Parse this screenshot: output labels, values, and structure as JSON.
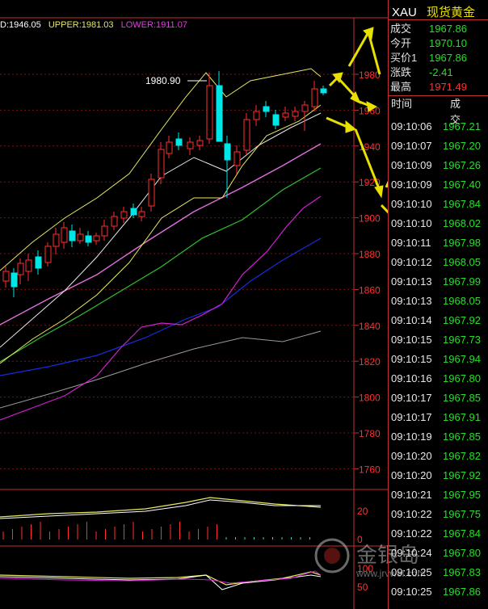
{
  "indicator_bar": {
    "mid": "D:1946.05",
    "upper": "UPPER:1981.03",
    "lower": "LOWER:1911.07"
  },
  "price_axis": [
    "1980",
    "1960",
    "1940",
    "1920",
    "1900",
    "1880",
    "1860",
    "1840",
    "1820",
    "1800",
    "1780",
    "1760"
  ],
  "high_annotation": "1980.90",
  "sub_axis_1": [
    "20",
    "0"
  ],
  "sub_axis_2": [
    "100",
    "50"
  ],
  "quote": {
    "symbol": "XAU",
    "name": "现货黄金",
    "rows": [
      {
        "label": "成交",
        "value": "1967.86",
        "color": "#25e025"
      },
      {
        "label": "今开",
        "value": "1970.10",
        "color": "#25e025"
      },
      {
        "label": "买价1",
        "value": "1967.86",
        "color": "#25e025"
      },
      {
        "label": "涨跌",
        "value": "-2.41",
        "color": "#25e025"
      },
      {
        "label": "最高",
        "value": "1971.49",
        "color": "#ff3030"
      }
    ]
  },
  "ticks": {
    "headers": {
      "time": "时间",
      "price": "成交"
    },
    "rows": [
      {
        "time": "09:10:06",
        "price": "1967.21"
      },
      {
        "time": "09:10:07",
        "price": "1967.20"
      },
      {
        "time": "09:10:09",
        "price": "1967.26"
      },
      {
        "time": "09:10:09",
        "price": "1967.40"
      },
      {
        "time": "09:10:10",
        "price": "1967.84"
      },
      {
        "time": "09:10:10",
        "price": "1968.02"
      },
      {
        "time": "09:10:11",
        "price": "1967.98"
      },
      {
        "time": "09:10:12",
        "price": "1968.05"
      },
      {
        "time": "09:10:13",
        "price": "1967.99"
      },
      {
        "time": "09:10:13",
        "price": "1968.05"
      },
      {
        "time": "09:10:14",
        "price": "1967.92"
      },
      {
        "time": "09:10:15",
        "price": "1967.73"
      },
      {
        "time": "09:10:15",
        "price": "1967.94"
      },
      {
        "time": "09:10:16",
        "price": "1967.80"
      },
      {
        "time": "09:10:17",
        "price": "1967.85"
      },
      {
        "time": "09:10:17",
        "price": "1967.91"
      },
      {
        "time": "09:10:19",
        "price": "1967.85"
      },
      {
        "time": "09:10:20",
        "price": "1967.82"
      },
      {
        "time": "09:10:20",
        "price": "1967.92"
      },
      {
        "time": "09:10:21",
        "price": "1967.95"
      },
      {
        "time": "09:10:22",
        "price": "1967.75"
      },
      {
        "time": "09:10:22",
        "price": "1967.84"
      },
      {
        "time": "09:10:24",
        "price": "1967.80"
      },
      {
        "time": "09:10:25",
        "price": "1967.83"
      },
      {
        "time": "09:10:25",
        "price": "1967.86"
      }
    ]
  },
  "watermark": {
    "brand": "金银岛",
    "url": "www.jrvwel.com"
  },
  "colors": {
    "up": "#ff3030",
    "down": "#00e5e5",
    "upper_band": "#e8e860",
    "lower_band": "#d020d0",
    "grid": "#8a1a1a",
    "annotation_arrow": "#e8e000"
  }
}
